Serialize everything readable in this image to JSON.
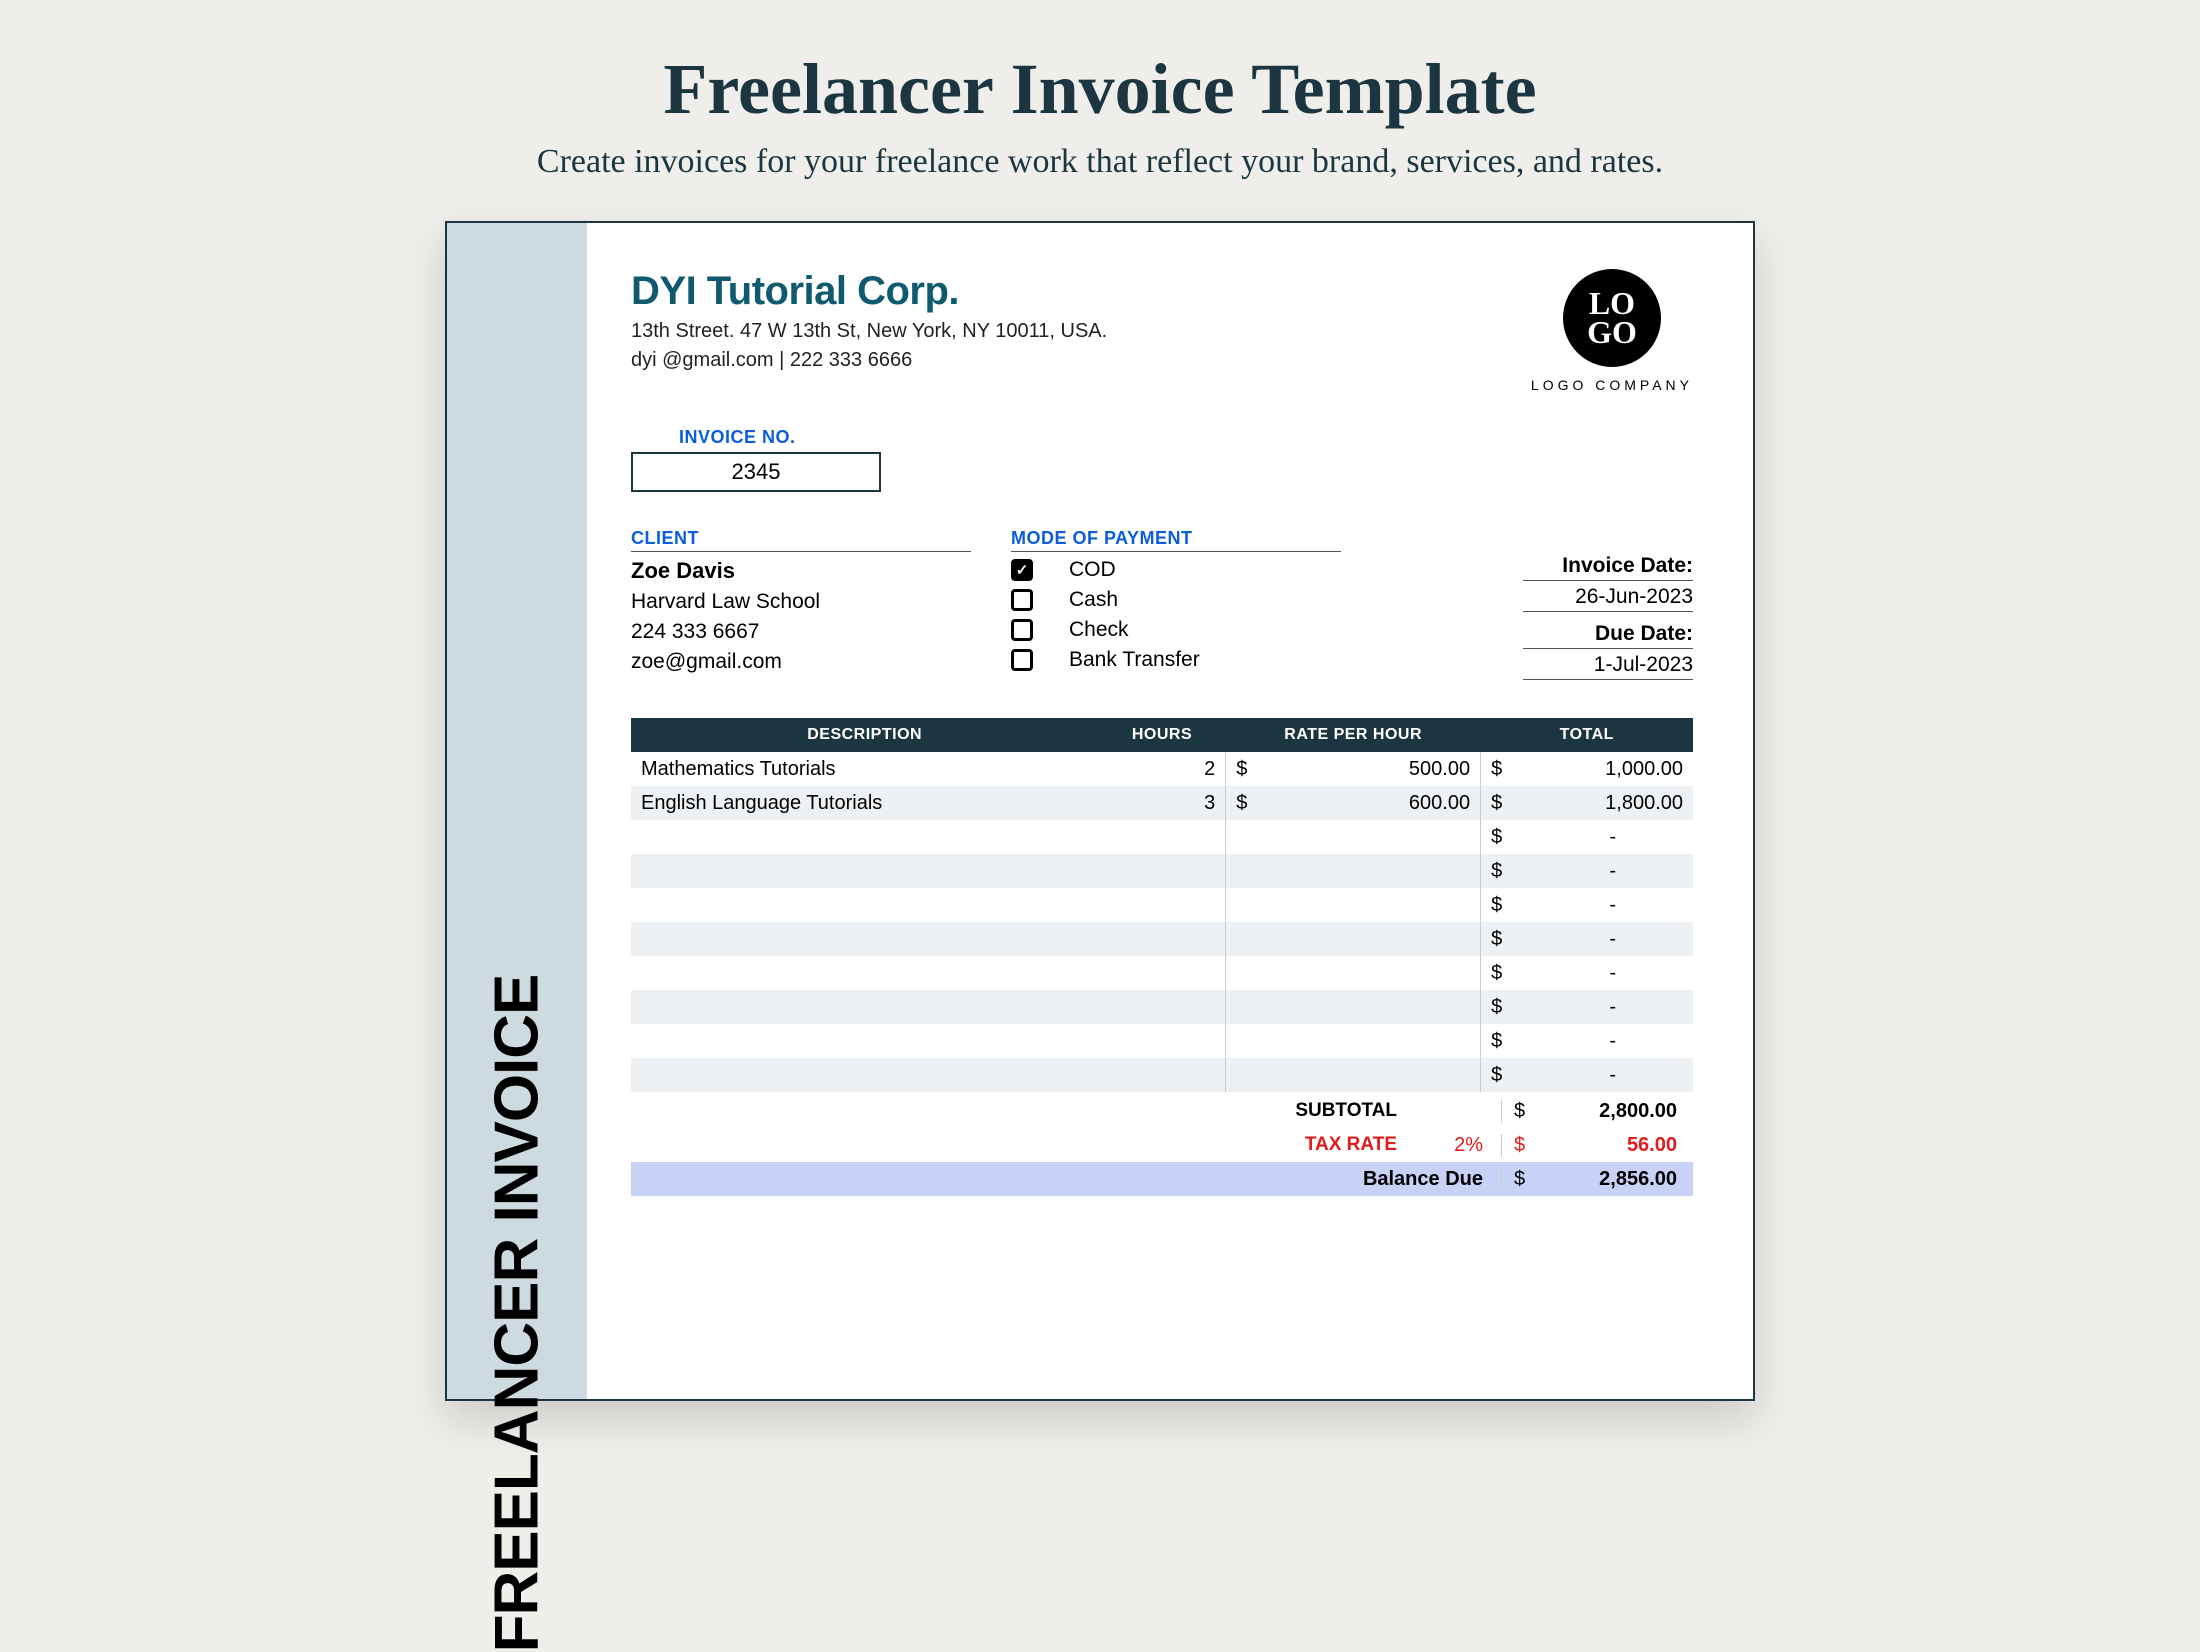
{
  "page": {
    "title": "Freelancer Invoice Template",
    "subtitle": "Create invoices for your freelance work that reflect your brand, services, and rates."
  },
  "sidebar": {
    "label": "FREELANCER INVOICE"
  },
  "company": {
    "name": "DYI Tutorial Corp.",
    "address": "13th Street. 47 W 13th St, New York, NY 10011, USA.",
    "contact": "dyi @gmail.com | 222 333 6666"
  },
  "logo": {
    "line1": "LO",
    "line2": "GO",
    "sub": "LOGO COMPANY"
  },
  "invoice_no": {
    "label": "INVOICE NO.",
    "value": "2345"
  },
  "client": {
    "heading": "CLIENT",
    "name": "Zoe Davis",
    "org": "Harvard Law School",
    "phone": "224 333 6667",
    "email": "zoe@gmail.com"
  },
  "payment": {
    "heading": "MODE OF PAYMENT",
    "options": [
      {
        "label": "COD",
        "checked": true
      },
      {
        "label": "Cash",
        "checked": false
      },
      {
        "label": "Check",
        "checked": false
      },
      {
        "label": "Bank Transfer",
        "checked": false
      }
    ]
  },
  "dates": {
    "invoice_label": "Invoice Date:",
    "invoice_value": "26-Jun-2023",
    "due_label": "Due Date:",
    "due_value": "1-Jul-2023"
  },
  "table": {
    "headers": {
      "desc": "DESCRIPTION",
      "hours": "HOURS",
      "rate": "RATE PER HOUR",
      "total": "TOTAL"
    },
    "currency": "$",
    "dash": "-",
    "rows": [
      {
        "desc": "Mathematics Tutorials",
        "hours": "2",
        "rate": "500.00",
        "total": "1,000.00"
      },
      {
        "desc": "English Language Tutorials",
        "hours": "3",
        "rate": "600.00",
        "total": "1,800.00"
      },
      {
        "desc": "",
        "hours": "",
        "rate": "",
        "total": "-"
      },
      {
        "desc": "",
        "hours": "",
        "rate": "",
        "total": "-"
      },
      {
        "desc": "",
        "hours": "",
        "rate": "",
        "total": "-"
      },
      {
        "desc": "",
        "hours": "",
        "rate": "",
        "total": "-"
      },
      {
        "desc": "",
        "hours": "",
        "rate": "",
        "total": "-"
      },
      {
        "desc": "",
        "hours": "",
        "rate": "",
        "total": "-"
      },
      {
        "desc": "",
        "hours": "",
        "rate": "",
        "total": "-"
      },
      {
        "desc": "",
        "hours": "",
        "rate": "",
        "total": "-"
      }
    ]
  },
  "summary": {
    "subtotal_label": "SUBTOTAL",
    "subtotal_value": "2,800.00",
    "tax_label": "TAX RATE",
    "tax_pct": "2%",
    "tax_value": "56.00",
    "balance_label": "Balance Due",
    "balance_value": "2,856.00"
  }
}
